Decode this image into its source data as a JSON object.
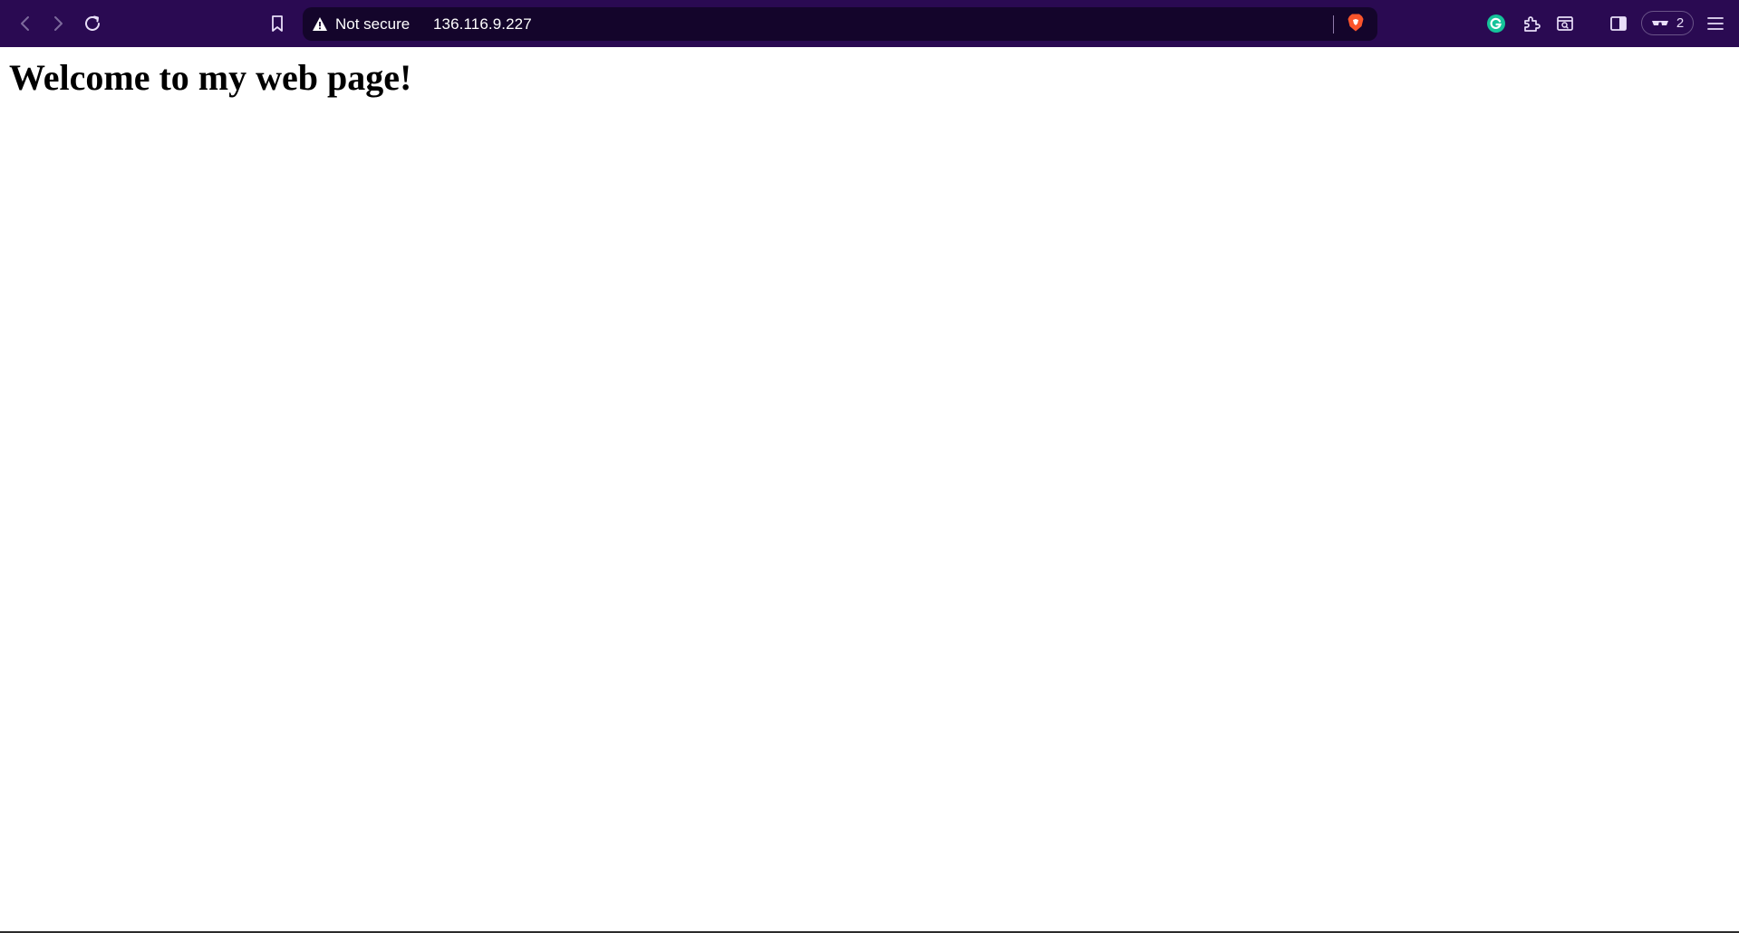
{
  "browser": {
    "security_label": "Not secure",
    "url": "136.116.9.227",
    "wallet_count": "2",
    "colors": {
      "toolbar_bg": "#2a0a52",
      "urlbar_bg": "#14052b",
      "brave_shield": "#fb542b",
      "grammarly": "#15c39a"
    },
    "icons": [
      "back-icon",
      "forward-icon",
      "reload-icon",
      "bookmark-icon",
      "warning-icon",
      "brave-shield-icon",
      "grammarly-icon",
      "extensions-icon",
      "tab-search-icon",
      "sidebar-icon",
      "wallet-icon",
      "menu-icon"
    ]
  },
  "page": {
    "heading": "Welcome to my web page!"
  }
}
